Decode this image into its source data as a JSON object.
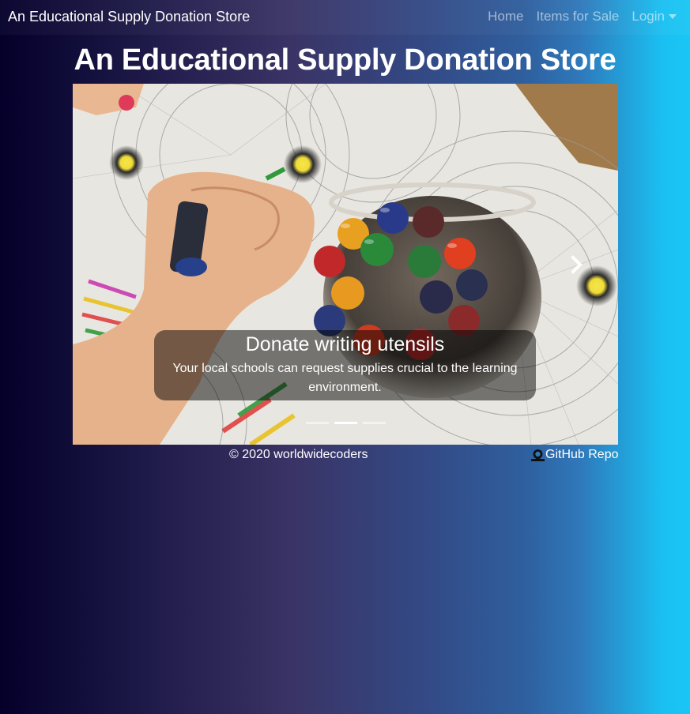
{
  "navbar": {
    "brand": "An Educational Supply Donation Store",
    "links": [
      {
        "label": "Home"
      },
      {
        "label": "Items for Sale"
      },
      {
        "label": "Login",
        "icon": "caret-down-icon"
      }
    ]
  },
  "page": {
    "title": "An Educational Supply Donation Store"
  },
  "carousel": {
    "active_index": 1,
    "slide_count": 3,
    "caption": {
      "title": "Donate writing utensils",
      "text": "Your local schools can request supplies crucial to the learning environment."
    },
    "next_icon": "chevron-right-icon"
  },
  "footer": {
    "copyright": "© 2020 worldwidecoders",
    "repo_label": "GitHub Repo",
    "repo_icon": "github-icon"
  }
}
